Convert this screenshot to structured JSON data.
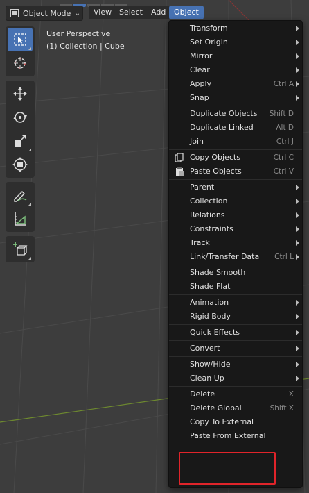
{
  "header": {
    "mode_select": {
      "label": "Object Mode"
    },
    "menus": [
      {
        "label": "View",
        "active": false
      },
      {
        "label": "Select",
        "active": false
      },
      {
        "label": "Add",
        "active": false
      },
      {
        "label": "Object",
        "active": true
      }
    ]
  },
  "viewport": {
    "perspective": "User Perspective",
    "collection": "(1) Collection | Cube"
  },
  "toolbar": {
    "tools": [
      {
        "name": "select-box-icon",
        "active": true
      },
      {
        "name": "cursor-icon",
        "active": false
      },
      {
        "name": "move-icon",
        "active": false
      },
      {
        "name": "rotate-icon",
        "active": false
      },
      {
        "name": "scale-icon",
        "active": false
      },
      {
        "name": "transform-icon",
        "active": false
      },
      {
        "name": "annotate-icon",
        "active": false
      },
      {
        "name": "measure-icon",
        "active": false
      },
      {
        "name": "add-cube-icon",
        "active": false
      }
    ]
  },
  "object_menu": {
    "sections": [
      {
        "items": [
          {
            "label": "Transform",
            "shortcut": "",
            "submenu": true
          },
          {
            "label": "Set Origin",
            "shortcut": "",
            "submenu": true
          },
          {
            "label": "Mirror",
            "shortcut": "",
            "submenu": true
          },
          {
            "label": "Clear",
            "shortcut": "",
            "submenu": true
          },
          {
            "label": "Apply",
            "shortcut": "Ctrl A",
            "submenu": true
          },
          {
            "label": "Snap",
            "shortcut": "",
            "submenu": true
          }
        ]
      },
      {
        "items": [
          {
            "label": "Duplicate Objects",
            "shortcut": "Shift D",
            "submenu": false
          },
          {
            "label": "Duplicate Linked",
            "shortcut": "Alt D",
            "submenu": false
          },
          {
            "label": "Join",
            "shortcut": "Ctrl J",
            "submenu": false
          }
        ]
      },
      {
        "items": [
          {
            "label": "Copy Objects",
            "shortcut": "Ctrl C",
            "submenu": false,
            "icon": "copy-icon"
          },
          {
            "label": "Paste Objects",
            "shortcut": "Ctrl V",
            "submenu": false,
            "icon": "paste-icon"
          }
        ]
      },
      {
        "items": [
          {
            "label": "Parent",
            "shortcut": "",
            "submenu": true
          },
          {
            "label": "Collection",
            "shortcut": "",
            "submenu": true
          },
          {
            "label": "Relations",
            "shortcut": "",
            "submenu": true
          },
          {
            "label": "Constraints",
            "shortcut": "",
            "submenu": true
          },
          {
            "label": "Track",
            "shortcut": "",
            "submenu": true
          },
          {
            "label": "Link/Transfer Data",
            "shortcut": "Ctrl L",
            "submenu": true
          }
        ]
      },
      {
        "items": [
          {
            "label": "Shade Smooth",
            "shortcut": "",
            "submenu": false
          },
          {
            "label": "Shade Flat",
            "shortcut": "",
            "submenu": false
          }
        ]
      },
      {
        "items": [
          {
            "label": "Animation",
            "shortcut": "",
            "submenu": true
          },
          {
            "label": "Rigid Body",
            "shortcut": "",
            "submenu": true
          }
        ]
      },
      {
        "items": [
          {
            "label": "Quick Effects",
            "shortcut": "",
            "submenu": true
          }
        ]
      },
      {
        "items": [
          {
            "label": "Convert",
            "shortcut": "",
            "submenu": true
          }
        ]
      },
      {
        "items": [
          {
            "label": "Show/Hide",
            "shortcut": "",
            "submenu": true
          },
          {
            "label": "Clean Up",
            "shortcut": "",
            "submenu": true
          }
        ]
      },
      {
        "items": [
          {
            "label": "Delete",
            "shortcut": "X",
            "submenu": false
          },
          {
            "label": "Delete Global",
            "shortcut": "Shift X",
            "submenu": false
          },
          {
            "label": "Copy To External",
            "shortcut": "",
            "submenu": false
          },
          {
            "label": "Paste From External",
            "shortcut": "",
            "submenu": false
          }
        ]
      }
    ]
  },
  "colors": {
    "accent": "#4772b3",
    "highlight_border": "#e0242a",
    "menu_bg": "#181818",
    "viewport_bg": "#3d3d3d"
  }
}
